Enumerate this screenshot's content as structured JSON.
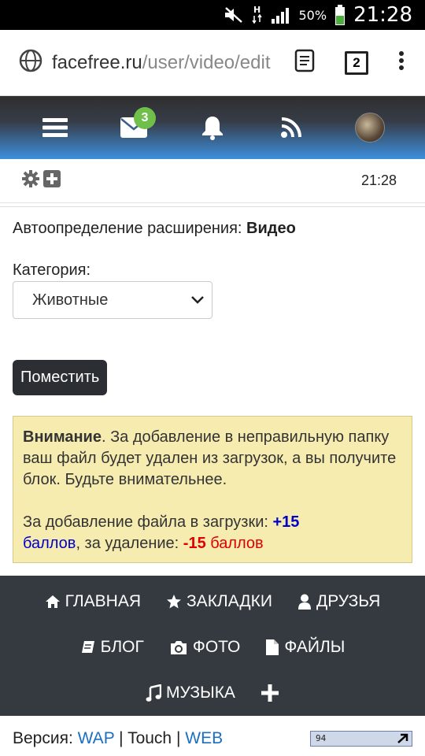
{
  "status_bar": {
    "battery_percent": "50%",
    "time": "21:28"
  },
  "browser": {
    "url_domain": "facefree.ru",
    "url_path": "/user/video/edit",
    "tab_count": "2"
  },
  "header": {
    "mail_badge": "3"
  },
  "toolbar": {
    "clock": "21:28"
  },
  "form": {
    "ext_label": "Автоопределение расширения:",
    "ext_value": "Видео",
    "category_label": "Категория:",
    "category_selected": "Животные",
    "submit_label": "Поместить"
  },
  "notice": {
    "title": "Внимание",
    "text": ". За добавление в неправильную папку ваш файл будет удален из загрузок, а вы получите блок. Будьте внимательнее.",
    "points_prefix": "За добавление файла в загрузки: ",
    "plus_value": "+15",
    "plus_unit": "баллов",
    "middle": ", за удаление: ",
    "minus_value": "-15",
    "minus_unit": " баллов"
  },
  "footer_nav": {
    "home": "ГЛАВНАЯ",
    "bookmarks": "ЗАКЛАДКИ",
    "friends": "ДРУЗЬЯ",
    "blog": "БЛОГ",
    "photo": "ФОТО",
    "files": "ФАЙЛЫ",
    "music": "МУЗЫКА"
  },
  "version": {
    "label": "Версия: ",
    "wap": "WAP",
    "sep": " | ",
    "touch": "Touch",
    "web": "WEB"
  },
  "counter": {
    "value": "94"
  }
}
